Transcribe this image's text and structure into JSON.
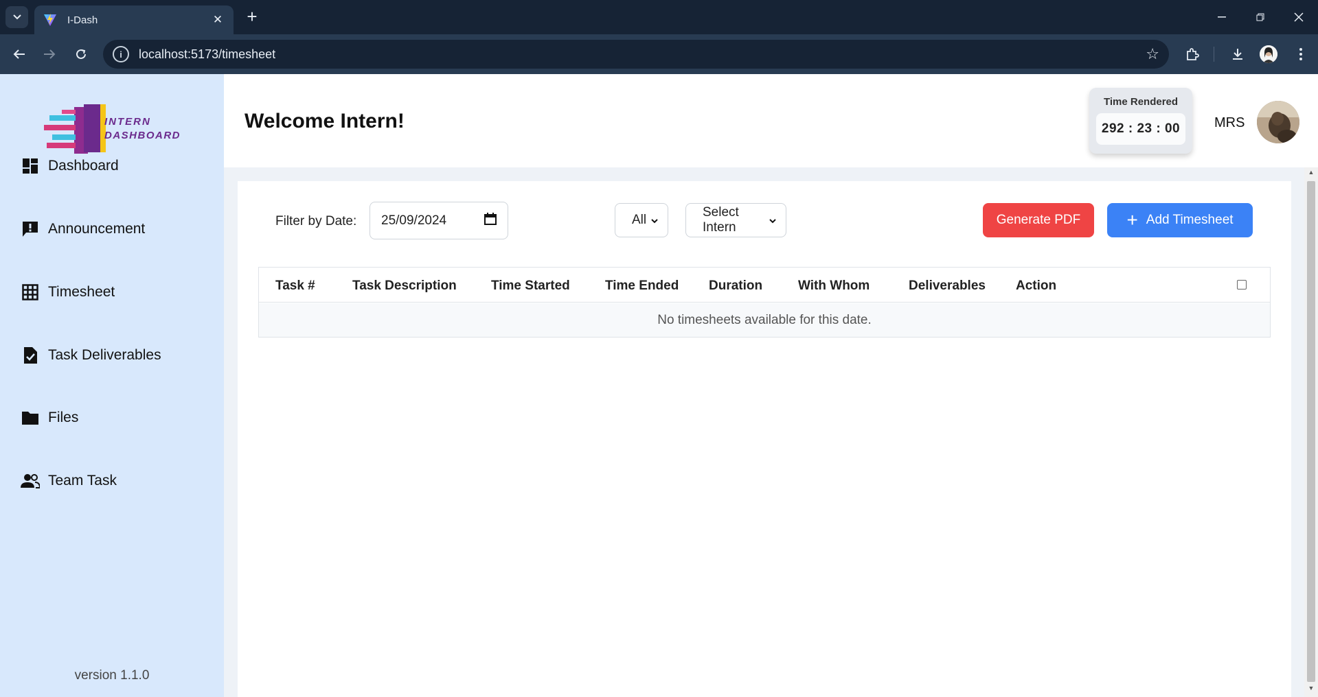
{
  "browser": {
    "tab_title": "I-Dash",
    "tab_close": "✕",
    "new_tab": "+",
    "url": "localhost:5173/timesheet"
  },
  "sidebar": {
    "items": [
      {
        "label": "Dashboard",
        "icon": "dashboard-icon"
      },
      {
        "label": "Announcement",
        "icon": "announcement-icon"
      },
      {
        "label": "Timesheet",
        "icon": "grid-icon"
      },
      {
        "label": "Task Deliverables",
        "icon": "document-check-icon"
      },
      {
        "label": "Files",
        "icon": "folder-icon"
      },
      {
        "label": "Team Task",
        "icon": "people-icon"
      }
    ],
    "version": "version 1.1.0"
  },
  "header": {
    "welcome": "Welcome Intern!",
    "time_rendered_label": "Time Rendered",
    "time_rendered_value": "292 : 23 : 00",
    "user_initials": "MRS"
  },
  "filters": {
    "filter_label": "Filter by Date:",
    "date_value": "25/09/2024",
    "status_select": "All",
    "intern_select": "Select Intern",
    "generate_pdf": "Generate PDF",
    "add_timesheet": "Add Timesheet"
  },
  "table": {
    "columns": [
      "Task #",
      "Task Description",
      "Time Started",
      "Time Ended",
      "Duration",
      "With Whom",
      "Deliverables",
      "Action"
    ],
    "empty_message": "No timesheets available for this date."
  },
  "colors": {
    "sidebar_bg": "#d8e8fc",
    "generate_pdf": "#ef4444",
    "add_timesheet": "#3b82f6"
  }
}
